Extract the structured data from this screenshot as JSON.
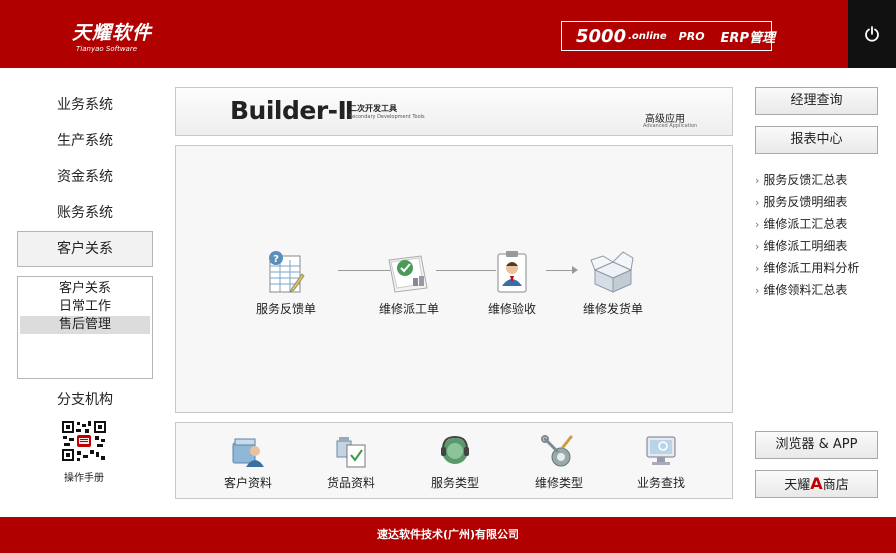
{
  "header": {
    "logo_cn": "天耀软件",
    "logo_en": "Tianyao Software",
    "product_main": "5000",
    "product_online": ".online",
    "product_pro": "PRO",
    "product_erp": "ERP管理"
  },
  "sidebar": {
    "items": [
      {
        "label": "业务系统"
      },
      {
        "label": "生产系统"
      },
      {
        "label": "资金系统"
      },
      {
        "label": "账务系统"
      },
      {
        "label": "客户关系"
      }
    ],
    "submenu": [
      {
        "label": "客户关系"
      },
      {
        "label": "日常工作"
      },
      {
        "label": "售后管理"
      }
    ],
    "branch": "分支机构",
    "manual": "操作手册"
  },
  "banner": {
    "title": "Builder-Ⅱ",
    "sub_cn": "二次开发工具",
    "sub_en": "Secondary Development Tools",
    "adv_cn": "高级应用",
    "adv_en": "Advanced Application"
  },
  "flow": [
    {
      "label": "服务反馈单",
      "icon": "feedback-form-icon"
    },
    {
      "label": "维修派工单",
      "icon": "repair-dispatch-icon"
    },
    {
      "label": "维修验收",
      "icon": "repair-acceptance-icon"
    },
    {
      "label": "维修发货单",
      "icon": "repair-shipping-icon"
    }
  ],
  "bottom": [
    {
      "label": "客户资料",
      "icon": "customer-profile-icon"
    },
    {
      "label": "货品资料",
      "icon": "goods-profile-icon"
    },
    {
      "label": "服务类型",
      "icon": "service-type-icon"
    },
    {
      "label": "维修类型",
      "icon": "repair-type-icon"
    },
    {
      "label": "业务查找",
      "icon": "business-search-icon"
    }
  ],
  "right": {
    "manager_query": "经理查询",
    "report_center": "报表中心",
    "reports": [
      {
        "label": "服务反馈汇总表"
      },
      {
        "label": "服务反馈明细表"
      },
      {
        "label": "维修派工汇总表"
      },
      {
        "label": "维修派工明细表"
      },
      {
        "label": "维修派工用料分析"
      },
      {
        "label": "维修领料汇总表"
      }
    ],
    "browser_app": "浏览器 & APP",
    "store_prefix": "天耀",
    "store_a": "A",
    "store_suffix": "商店"
  },
  "footer": {
    "company": "速达软件技术(广州)有限公司"
  },
  "colors": {
    "brand_red": "#b00000",
    "power_bg": "#111111"
  }
}
